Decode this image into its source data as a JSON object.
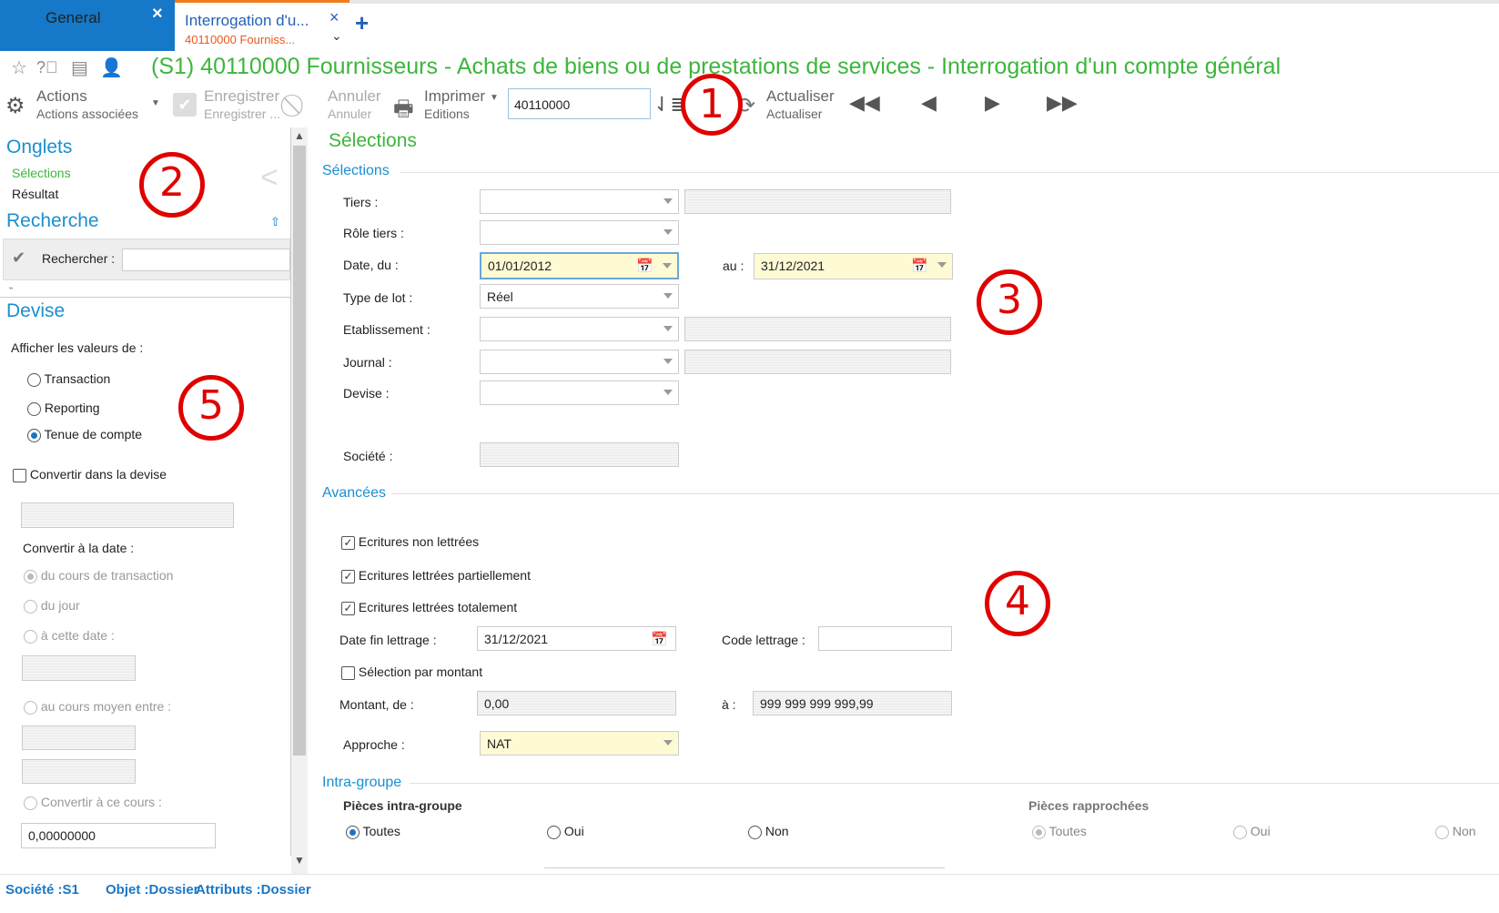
{
  "tabs": {
    "general": {
      "label": "General"
    },
    "active": {
      "label": "Interrogation d'u...",
      "sublabel": "40110000 Fourniss..."
    }
  },
  "title": "(S1)  40110000 Fournisseurs - Achats de biens ou de prestations de services - Interrogation d'un compte général",
  "toolbar": {
    "actions": {
      "label": "Actions",
      "sub": "Actions associées"
    },
    "enregistrer": {
      "label": "Enregistrer",
      "sub": "Enregistrer ..."
    },
    "annuler": {
      "label": "Annuler",
      "sub": "Annuler"
    },
    "imprimer": {
      "label": "Imprimer",
      "sub": "Editions"
    },
    "account_value": "40110000",
    "actualiser": {
      "label": "Actualiser",
      "sub": "Actualiser"
    }
  },
  "annotations": [
    "1",
    "2",
    "3",
    "4",
    "5"
  ],
  "left": {
    "onglets": {
      "title": "Onglets",
      "items": [
        "Sélections",
        "Résultat"
      ]
    },
    "recherche": {
      "title": "Recherche",
      "label": "Rechercher :",
      "value": ""
    },
    "devise": {
      "title": "Devise",
      "afficher": "Afficher les valeurs de :",
      "options": [
        "Transaction",
        "Reporting",
        "Tenue de compte"
      ],
      "selected": "Tenue de compte",
      "convertir": "Convertir dans la devise",
      "convertir_date": "Convertir à la date :",
      "date_options": [
        "du cours de transaction",
        "du jour",
        "à cette date :",
        "au cours moyen entre :",
        "Convertir à ce cours :"
      ],
      "cours_value": "0,00000000"
    }
  },
  "main": {
    "header": "Sélections",
    "selections": {
      "group": "Sélections",
      "tiers": "Tiers :",
      "role_tiers": "Rôle tiers :",
      "date_du": "Date, du :",
      "date_du_value": "01/01/2012",
      "au": "au :",
      "date_au_value": "31/12/2021",
      "type_lot": "Type de lot :",
      "type_lot_value": "Réel",
      "etablissement": "Etablissement :",
      "journal": "Journal :",
      "devise": "Devise :",
      "societe": "Société :"
    },
    "avancees": {
      "group": "Avancées",
      "chk1": "Ecritures non lettrées",
      "chk2": "Ecritures lettrées partiellement",
      "chk3": "Ecritures lettrées totalement",
      "date_fin": "Date fin lettrage :",
      "date_fin_value": "31/12/2021",
      "code_lettrage": "Code lettrage :",
      "selection_montant": "Sélection par montant",
      "montant_de": "Montant, de :",
      "montant_de_value": "0,00",
      "a": "à :",
      "montant_a_value": "999 999 999 999,99",
      "approche": "Approche :",
      "approche_value": "NAT"
    },
    "intra": {
      "group": "Intra-groupe",
      "pieces_intra": "Pièces intra-groupe",
      "pieces_rapprochees": "Pièces rapprochées",
      "opts": [
        "Toutes",
        "Oui",
        "Non"
      ]
    }
  },
  "status": {
    "societe": "Société :S1",
    "objet": "Objet :Dossier",
    "attributs": "Attributs :Dossier"
  },
  "colors": {
    "accent_blue": "#1578c8",
    "title_green": "#3db53d",
    "annotation_red": "#e00000"
  }
}
